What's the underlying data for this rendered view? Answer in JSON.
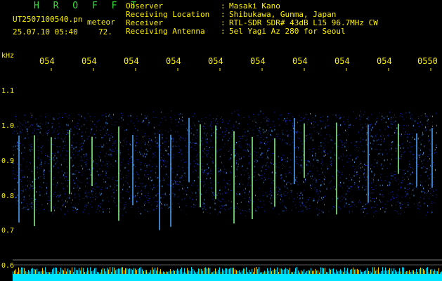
{
  "header": {
    "title": "H R O F F T",
    "filename": "UT2507100540.pn",
    "file_suffix": "meteor",
    "datetime": "25.07.10 05:40",
    "ratio": "72.",
    "meta": [
      {
        "label": "Observer",
        "value": "Masaki Kano"
      },
      {
        "label": "Receiving Location",
        "value": "Shibukawa, Gunma, Japan"
      },
      {
        "label": "Receiver",
        "value": "RTL-SDR SDR# 43dB L15 96.7MHz CW"
      },
      {
        "label": "Receiving Antenna",
        "value": "5el Yagi Az 280 for Seoul"
      }
    ]
  },
  "axes": {
    "y_unit": "kHz",
    "y_ticks": [
      "1.1",
      "1.0",
      "0.9",
      "0.8",
      "0.7",
      "0.6"
    ],
    "x_ticks": [
      "054",
      "054",
      "054",
      "054",
      "054",
      "054",
      "054",
      "054",
      "054",
      "0550"
    ]
  },
  "colors": {
    "label": "#fff200",
    "title": "#3cde3c",
    "noise": "#1a3cff",
    "noise_bright": "#4fa8ff",
    "meteor": "#8cff8c",
    "baseline": "#00e5ff",
    "spike": "#ffd000"
  }
}
